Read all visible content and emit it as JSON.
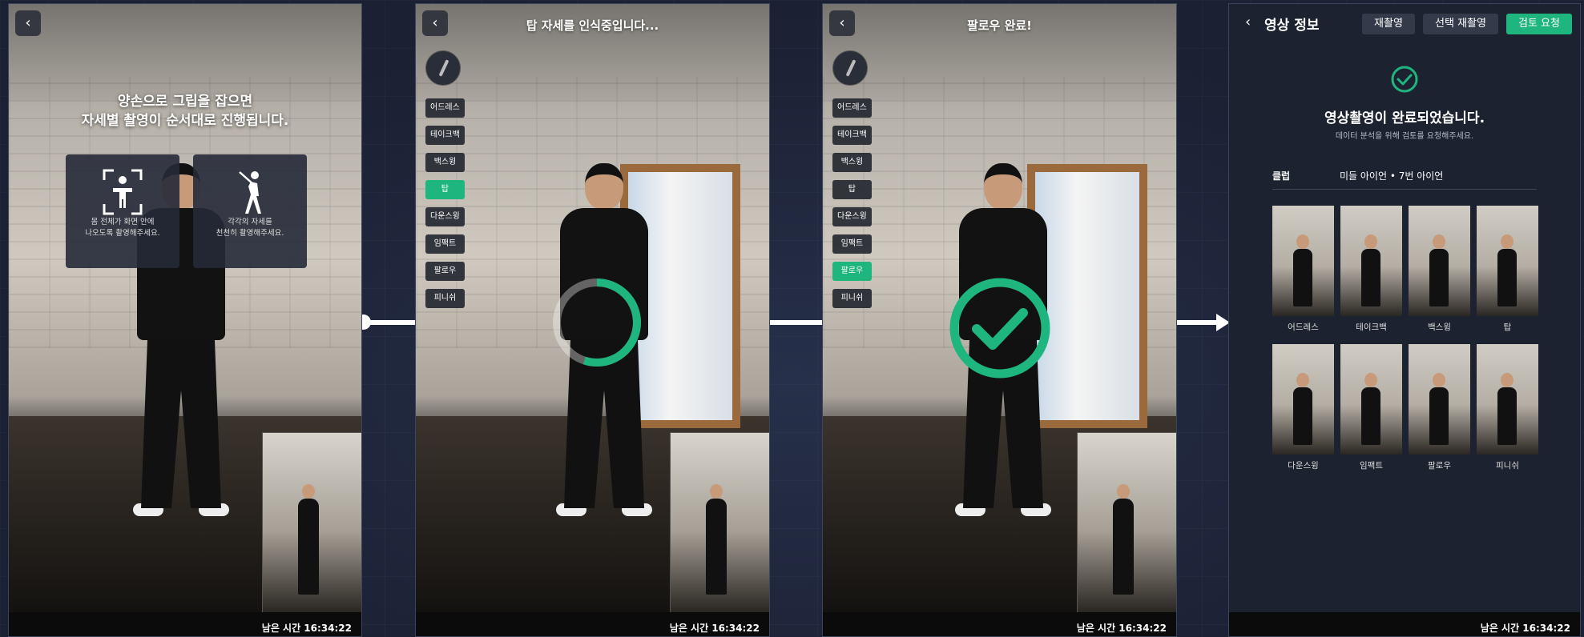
{
  "panel1": {
    "back_icon": "chevron-left-icon",
    "guide_line1": "양손으로 그립을 잡으면",
    "guide_line2": "자세별 촬영이 순서대로 진행됩니다.",
    "card1_line1": "몸 전체가 화면 안에",
    "card1_line2": "나오도록 촬영해주세요.",
    "card2_line1": "각각의 자세를",
    "card2_line2": "천천히 촬영해주세요.",
    "footer": "남은 시간 16:34:22"
  },
  "panel2": {
    "top_message": "탑 자세를 인식중입니다...",
    "steps": [
      "어드레스",
      "테이크백",
      "백스윙",
      "탑",
      "다운스윙",
      "임팩트",
      "팔로우",
      "피니쉬"
    ],
    "active_step": "탑",
    "progress": 0.55,
    "footer": "남은 시간 16:34:22"
  },
  "panel3": {
    "top_message": "팔로우 완료!",
    "steps": [
      "어드레스",
      "테이크백",
      "백스윙",
      "탑",
      "다운스윙",
      "임팩트",
      "팔로우",
      "피니쉬"
    ],
    "active_step": "팔로우",
    "footer": "남은 시간 16:34:22"
  },
  "panel4": {
    "title": "영상 정보",
    "btn_reshoot": "재촬영",
    "btn_select_reshoot": "선택 재촬영",
    "btn_review": "검토 요청",
    "done_title": "영상촬영이 완료되었습니다.",
    "done_sub": "데이터 분석을 위해 검토를 요청해주세요.",
    "club_label": "클럽",
    "club_value": "미들 아이언 • 7번 아이언",
    "thumbs": [
      "어드레스",
      "테이크백",
      "백스윙",
      "탑",
      "다운스윙",
      "임팩트",
      "팔로우",
      "피니쉬"
    ],
    "footer": "남은 시간 16:34:22"
  },
  "colors": {
    "accent": "#1fb57e",
    "background": "#1b2032"
  }
}
